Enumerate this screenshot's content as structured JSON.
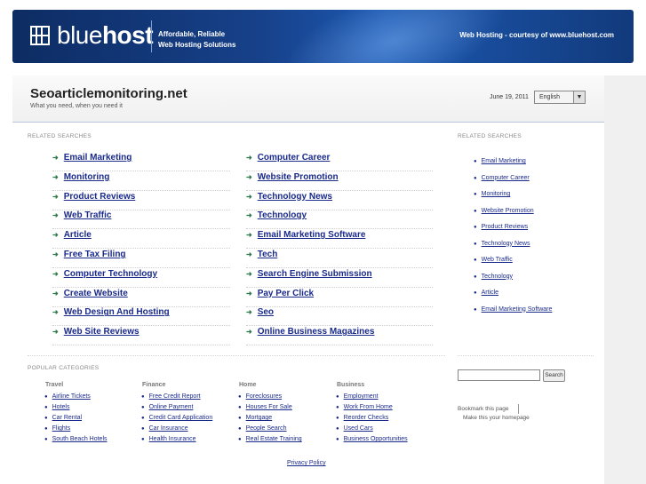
{
  "banner": {
    "logo_text_light": "blue",
    "logo_text_bold": "host",
    "tagline_line1": "Affordable, Reliable",
    "tagline_line2": "Web Hosting Solutions",
    "courtesy": "Web Hosting - courtesy of www.bluehost.com"
  },
  "header": {
    "title": "Seoarticlemonitoring.net",
    "subtitle": "What you need, when you need it",
    "date": "June 19, 2011",
    "language": "English"
  },
  "related": {
    "label": "RELATED SEARCHES",
    "left": [
      "Email Marketing",
      "Monitoring",
      "Product Reviews",
      "Web Traffic",
      "Article",
      "Free Tax Filing",
      "Computer Technology",
      "Create Website",
      "Web Design And Hosting",
      "Web Site Reviews"
    ],
    "right": [
      "Computer Career",
      "Website Promotion",
      "Technology News",
      "Technology",
      "Email Marketing Software",
      "Tech",
      "Search Engine Submission",
      "Pay Per Click",
      "Seo",
      "Online Business Magazines"
    ]
  },
  "sidebar": {
    "label": "RELATED SEARCHES",
    "items": [
      "Email Marketing",
      "Computer Career",
      "Monitoring",
      "Website Promotion",
      "Product Reviews",
      "Technology News",
      "Web Traffic",
      "Technology",
      "Article",
      "Email Marketing Software"
    ],
    "search_button": "Search",
    "bookmark": "Bookmark this page",
    "homepage": "Make this your homepage"
  },
  "popular": {
    "label": "POPULAR CATEGORIES",
    "columns": [
      {
        "title": "Travel",
        "items": [
          "Airline Tickets",
          "Hotels",
          "Car Rental",
          "Flights",
          "South Beach Hotels"
        ]
      },
      {
        "title": "Finance",
        "items": [
          "Free Credit Report",
          "Online Payment",
          "Credit Card Application",
          "Car Insurance",
          "Health Insurance"
        ]
      },
      {
        "title": "Home",
        "items": [
          "Foreclosures",
          "Houses For Sale",
          "Mortgage",
          "People Search",
          "Real Estate Training"
        ]
      },
      {
        "title": "Business",
        "items": [
          "Employment",
          "Work From Home",
          "Reorder Checks",
          "Used Cars",
          "Business Opportunities"
        ]
      }
    ]
  },
  "footer": {
    "privacy": "Privacy Policy"
  }
}
